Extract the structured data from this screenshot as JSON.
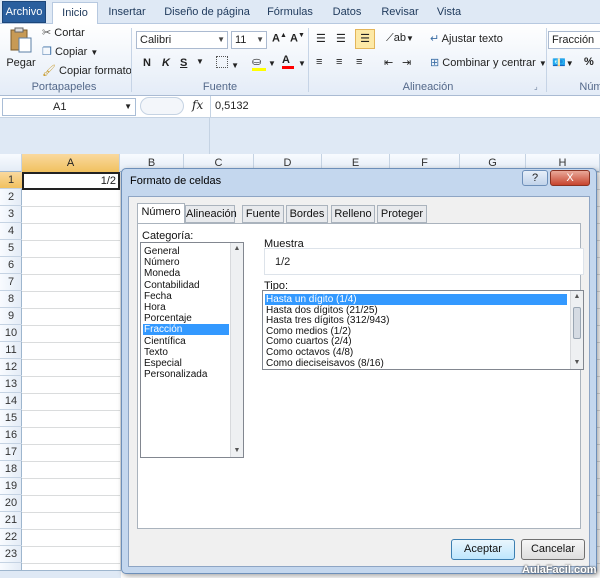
{
  "tabs": [
    {
      "label": "Archivo",
      "kind": "file"
    },
    {
      "label": "Inicio",
      "kind": "active"
    },
    {
      "label": "Insertar"
    },
    {
      "label": "Diseño de página"
    },
    {
      "label": "Fórmulas"
    },
    {
      "label": "Datos"
    },
    {
      "label": "Revisar"
    },
    {
      "label": "Vista"
    }
  ],
  "ribbon": {
    "clipboard": {
      "paste": "Pegar",
      "cut": "Cortar",
      "copy": "Copiar",
      "format_painter": "Copiar formato",
      "group": "Portapapeles"
    },
    "font": {
      "name": "Calibri",
      "size": "11",
      "bold": "N",
      "italic": "K",
      "underline": "S",
      "group": "Fuente",
      "font_color": "#ff0000",
      "fill_color": "#ffff00"
    },
    "alignment": {
      "wrap": "Ajustar texto",
      "merge": "Combinar y centrar",
      "group": "Alineación"
    },
    "number": {
      "format": "Fracción",
      "group": "Núm"
    }
  },
  "formula_bar": {
    "name_box": "A1",
    "fx": "fx",
    "value": "0,5132"
  },
  "grid": {
    "columns": [
      "A",
      "B",
      "C",
      "D",
      "E",
      "F",
      "G",
      "H"
    ],
    "rows": [
      "1",
      "2",
      "3",
      "4",
      "5",
      "6",
      "7",
      "8",
      "9",
      "10",
      "11",
      "12",
      "13",
      "14",
      "15",
      "16",
      "17",
      "18",
      "19",
      "20",
      "21",
      "22",
      "23"
    ],
    "a1_value": "1/2"
  },
  "dialog": {
    "title": "Formato de celdas",
    "help": "?",
    "close": "X",
    "tabs": [
      "Número",
      "Alineación",
      "Fuente",
      "Bordes",
      "Relleno",
      "Proteger"
    ],
    "category_label": "Categoría:",
    "categories": [
      "General",
      "Número",
      "Moneda",
      "Contabilidad",
      "Fecha",
      "Hora",
      "Porcentaje",
      "Fracción",
      "Científica",
      "Texto",
      "Especial",
      "Personalizada"
    ],
    "selected_category": "Fracción",
    "sample_label": "Muestra",
    "sample_value": "1/2",
    "type_label": "Tipo:",
    "types": [
      "Hasta un dígito (1/4)",
      "Hasta dos dígitos (21/25)",
      "Hasta tres dígitos (312/943)",
      "Como medios (1/2)",
      "Como cuartos (2/4)",
      "Como octavos (4/8)",
      "Como dieciseisavos (8/16)"
    ],
    "selected_type": "Hasta un dígito (1/4)",
    "ok": "Aceptar",
    "cancel": "Cancelar"
  },
  "watermark": "AulaFacil.com"
}
